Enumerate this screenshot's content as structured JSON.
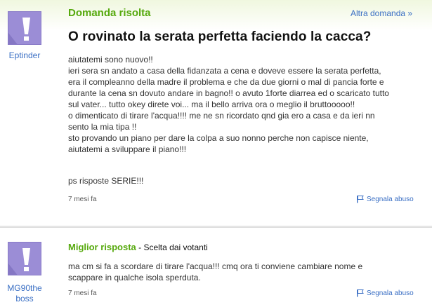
{
  "question": {
    "status": "Domanda risolta",
    "other_link": "Altra domanda »",
    "asker": "Eptinder",
    "title": "O rovinato la serata perfetta faciendo la cacca?",
    "body_lines": [
      "aiutatemi sono nuovo!!",
      "ieri sera sn andato a casa della fidanzata a cena e doveve essere la serata perfetta,",
      "era il compleanno della madre il problema e che da due giorni o mal di pancia forte e",
      "durante la cena sn dovuto andare in bagno!! o avuto 1forte diarrea ed o scaricato tutto",
      "sul vater... tutto okey direte voi... ma il bello arriva ora o meglio il bruttooooo!!",
      "o dimenticato di tirare l'acqua!!!! me ne sn ricordato qnd gia ero a casa e da ieri nn",
      "sento la mia tipa !!",
      "sto provando un piano per dare la colpa a suo nonno perche non capisce niente,",
      "aiutatemi a sviluppare il piano!!!"
    ],
    "ps": "ps risposte SERIE!!!",
    "time_ago": "7 mesi fa",
    "report_label": "Segnala abuso"
  },
  "best_answer": {
    "label": "Miglior risposta",
    "sublabel": " - Scelta dai votanti",
    "answerer_line1": "MG90the",
    "answerer_line2": "boss",
    "body_lines": [
      "ma cm si fa a scordare di tirare l'acqua!!! cmq ora ti conviene cambiare nome e",
      "scappare in qualche isola sperduta."
    ],
    "time_ago": "7 mesi fa",
    "report_label": "Segnala abuso"
  },
  "icons": {
    "avatar": "purple-exclamation-avatar",
    "report": "flag-icon"
  },
  "colors": {
    "accent_green": "#56a90d",
    "link_blue": "#3a6fc4",
    "avatar_purple": "#9b8dd6"
  }
}
